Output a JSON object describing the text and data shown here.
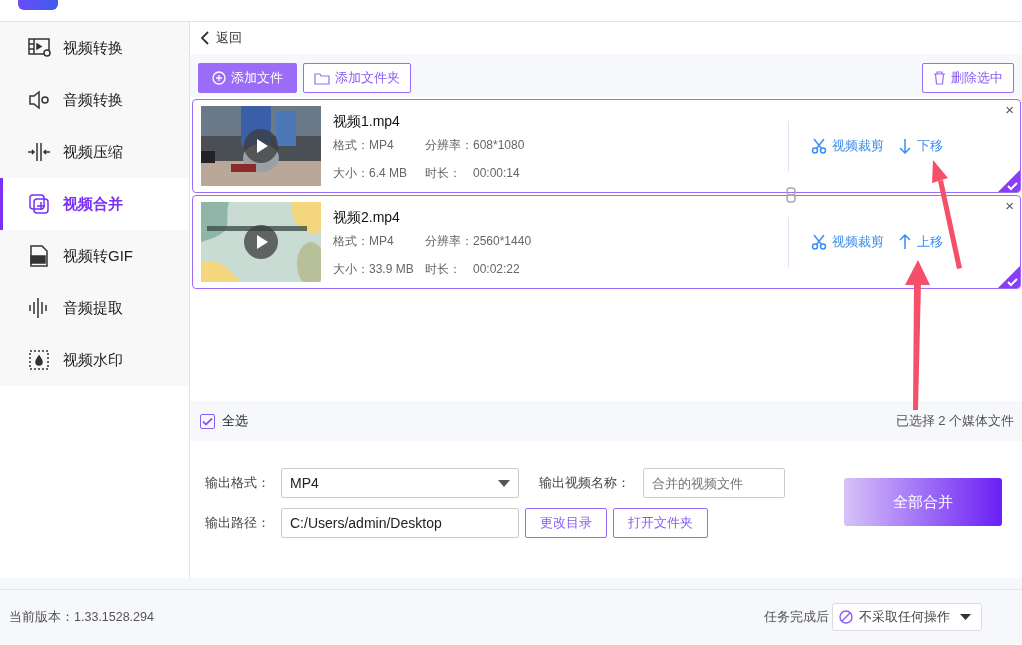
{
  "sidebar": {
    "items": [
      {
        "label": "视频转换",
        "selected": false
      },
      {
        "label": "音频转换",
        "selected": false
      },
      {
        "label": "视频压缩",
        "selected": false
      },
      {
        "label": "视频合并",
        "selected": true
      },
      {
        "label": "视频转GIF",
        "selected": false
      },
      {
        "label": "音频提取",
        "selected": false
      },
      {
        "label": "视频水印",
        "selected": false
      }
    ]
  },
  "back": {
    "label": "返回"
  },
  "toolbar": {
    "add_file": "添加文件",
    "add_folder": "添加文件夹",
    "delete_selected": "删除选中"
  },
  "files": [
    {
      "name": "视频1.mp4",
      "selected": true,
      "close": "×",
      "fields": [
        {
          "label": "格式：",
          "value": "MP4"
        },
        {
          "label": "分辨率：",
          "value": "608*1080"
        },
        {
          "label": "大小：",
          "value": "6.4 MB"
        },
        {
          "label": "时长：",
          "value": "00:00:14"
        }
      ],
      "actions": [
        {
          "kind": "crop",
          "label": "视频裁剪"
        },
        {
          "kind": "down",
          "label": "下移"
        }
      ]
    },
    {
      "name": "视频2.mp4",
      "selected": true,
      "close": "×",
      "fields": [
        {
          "label": "格式：",
          "value": "MP4"
        },
        {
          "label": "分辨率：",
          "value": "2560*1440"
        },
        {
          "label": "大小：",
          "value": "33.9 MB"
        },
        {
          "label": "时长：",
          "value": "00:02:22"
        }
      ],
      "actions": [
        {
          "kind": "crop",
          "label": "视频裁剪"
        },
        {
          "kind": "up",
          "label": "上移"
        }
      ]
    }
  ],
  "select_all": {
    "label": "全选",
    "checked": true,
    "summary": "已选择 2 个媒体文件"
  },
  "output": {
    "format_label": "输出格式：",
    "format": "MP4",
    "name_label": "输出视频名称：",
    "name_placeholder": "合并的视频文件",
    "path_label": "输出路径：",
    "path": "C:/Users/admin/Desktop",
    "change_dir": "更改目录",
    "open_folder": "打开文件夹",
    "merge": "全部合并"
  },
  "footer": {
    "version": "当前版本：1.33.1528.294",
    "after_label": "任务完成后",
    "after_value": "不采取任何操作"
  }
}
